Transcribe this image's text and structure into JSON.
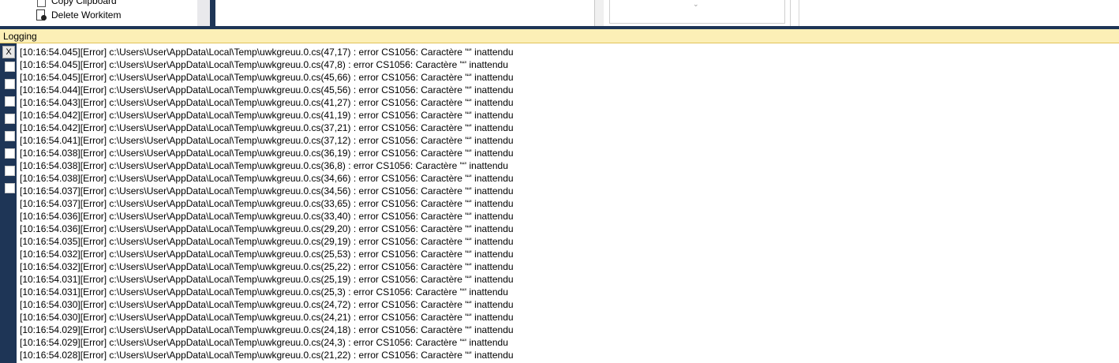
{
  "menu": {
    "copy_label": "Copy Clipboard",
    "delete_label": "Delete Workitem"
  },
  "logging": {
    "title": "Logging",
    "close_label": "X",
    "lines": [
      "[10:16:54.045][Error] c:\\Users\\User\\AppData\\Local\\Temp\\uwkgreuu.0.cs(47,17) : error CS1056: Caractère '“' inattendu",
      "[10:16:54.045][Error] c:\\Users\\User\\AppData\\Local\\Temp\\uwkgreuu.0.cs(47,8) : error CS1056: Caractère '“' inattendu",
      "[10:16:54.045][Error] c:\\Users\\User\\AppData\\Local\\Temp\\uwkgreuu.0.cs(45,66) : error CS1056: Caractère '“' inattendu",
      "[10:16:54.044][Error] c:\\Users\\User\\AppData\\Local\\Temp\\uwkgreuu.0.cs(45,56) : error CS1056: Caractère '“' inattendu",
      "[10:16:54.043][Error] c:\\Users\\User\\AppData\\Local\\Temp\\uwkgreuu.0.cs(41,27) : error CS1056: Caractère '“' inattendu",
      "[10:16:54.042][Error] c:\\Users\\User\\AppData\\Local\\Temp\\uwkgreuu.0.cs(41,19) : error CS1056: Caractère '“' inattendu",
      "[10:16:54.042][Error] c:\\Users\\User\\AppData\\Local\\Temp\\uwkgreuu.0.cs(37,21) : error CS1056: Caractère '“' inattendu",
      "[10:16:54.041][Error] c:\\Users\\User\\AppData\\Local\\Temp\\uwkgreuu.0.cs(37,12) : error CS1056: Caractère '“' inattendu",
      "[10:16:54.038][Error] c:\\Users\\User\\AppData\\Local\\Temp\\uwkgreuu.0.cs(36,19) : error CS1056: Caractère '“' inattendu",
      "[10:16:54.038][Error] c:\\Users\\User\\AppData\\Local\\Temp\\uwkgreuu.0.cs(36,8) : error CS1056: Caractère '“' inattendu",
      "[10:16:54.038][Error] c:\\Users\\User\\AppData\\Local\\Temp\\uwkgreuu.0.cs(34,66) : error CS1056: Caractère '“' inattendu",
      "[10:16:54.037][Error] c:\\Users\\User\\AppData\\Local\\Temp\\uwkgreuu.0.cs(34,56) : error CS1056: Caractère '“' inattendu",
      "[10:16:54.037][Error] c:\\Users\\User\\AppData\\Local\\Temp\\uwkgreuu.0.cs(33,65) : error CS1056: Caractère '“' inattendu",
      "[10:16:54.036][Error] c:\\Users\\User\\AppData\\Local\\Temp\\uwkgreuu.0.cs(33,40) : error CS1056: Caractère '“' inattendu",
      "[10:16:54.036][Error] c:\\Users\\User\\AppData\\Local\\Temp\\uwkgreuu.0.cs(29,20) : error CS1056: Caractère '“' inattendu",
      "[10:16:54.035][Error] c:\\Users\\User\\AppData\\Local\\Temp\\uwkgreuu.0.cs(29,19) : error CS1056: Caractère '“' inattendu",
      "[10:16:54.032][Error] c:\\Users\\User\\AppData\\Local\\Temp\\uwkgreuu.0.cs(25,53) : error CS1056: Caractère '“' inattendu",
      "[10:16:54.032][Error] c:\\Users\\User\\AppData\\Local\\Temp\\uwkgreuu.0.cs(25,22) : error CS1056: Caractère '“' inattendu",
      "[10:16:54.031][Error] c:\\Users\\User\\AppData\\Local\\Temp\\uwkgreuu.0.cs(25,19) : error CS1056: Caractère '“' inattendu",
      "[10:16:54.031][Error] c:\\Users\\User\\AppData\\Local\\Temp\\uwkgreuu.0.cs(25,3) : error CS1056: Caractère '“' inattendu",
      "[10:16:54.030][Error] c:\\Users\\User\\AppData\\Local\\Temp\\uwkgreuu.0.cs(24,72) : error CS1056: Caractère '“' inattendu",
      "[10:16:54.030][Error] c:\\Users\\User\\AppData\\Local\\Temp\\uwkgreuu.0.cs(24,21) : error CS1056: Caractère '“' inattendu",
      "[10:16:54.029][Error] c:\\Users\\User\\AppData\\Local\\Temp\\uwkgreuu.0.cs(24,18) : error CS1056: Caractère '“' inattendu",
      "[10:16:54.029][Error] c:\\Users\\User\\AppData\\Local\\Temp\\uwkgreuu.0.cs(24,3) : error CS1056: Caractère '“' inattendu",
      "[10:16:54.028][Error] c:\\Users\\User\\AppData\\Local\\Temp\\uwkgreuu.0.cs(21,22) : error CS1056: Caractère '“' inattendu"
    ]
  },
  "colors": {
    "header_bg": "#fcefb6",
    "frame_dark": "#1e3556"
  },
  "icons": {
    "copy": "copy-clipboard-icon",
    "delete": "delete-workitem-icon",
    "chevron": "chevron-down-icon"
  }
}
